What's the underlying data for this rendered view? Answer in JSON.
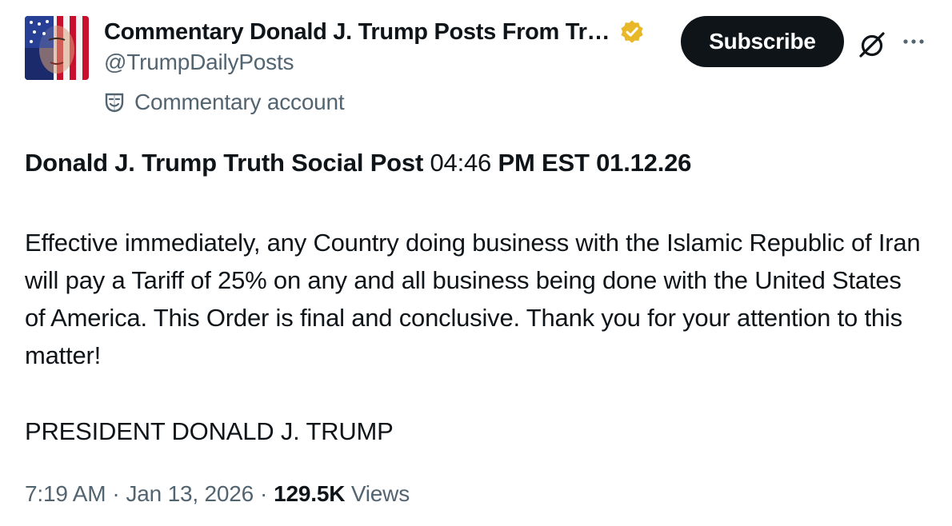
{
  "author": {
    "display_name": "Commentary Donald J. Trump Posts From Tr…",
    "handle": "@TrumpDailyPosts",
    "label": "Commentary account",
    "verified": true,
    "verified_badge_color": "#e8b829"
  },
  "header": {
    "subscribe_label": "Subscribe"
  },
  "post": {
    "title_bold": "Donald J. Trump Truth Social Post",
    "title_time": "04:46",
    "title_rest": "PM EST 01.12.26",
    "body": "Effective immediately, any Country doing business with the Islamic Republic of Iran will pay a Tariff of 25% on any and all business being done with the United States of America. This Order is final and conclusive. Thank you for your attention to this matter!",
    "signature": "PRESIDENT DONALD J. TRUMP"
  },
  "meta": {
    "time": "7:19 AM",
    "separator": "·",
    "date": "Jan 13, 2026",
    "views_count": "129.5K",
    "views_label": "Views"
  },
  "colors": {
    "text": "#0f1419",
    "secondary": "#536471",
    "button": "#0f1419"
  }
}
